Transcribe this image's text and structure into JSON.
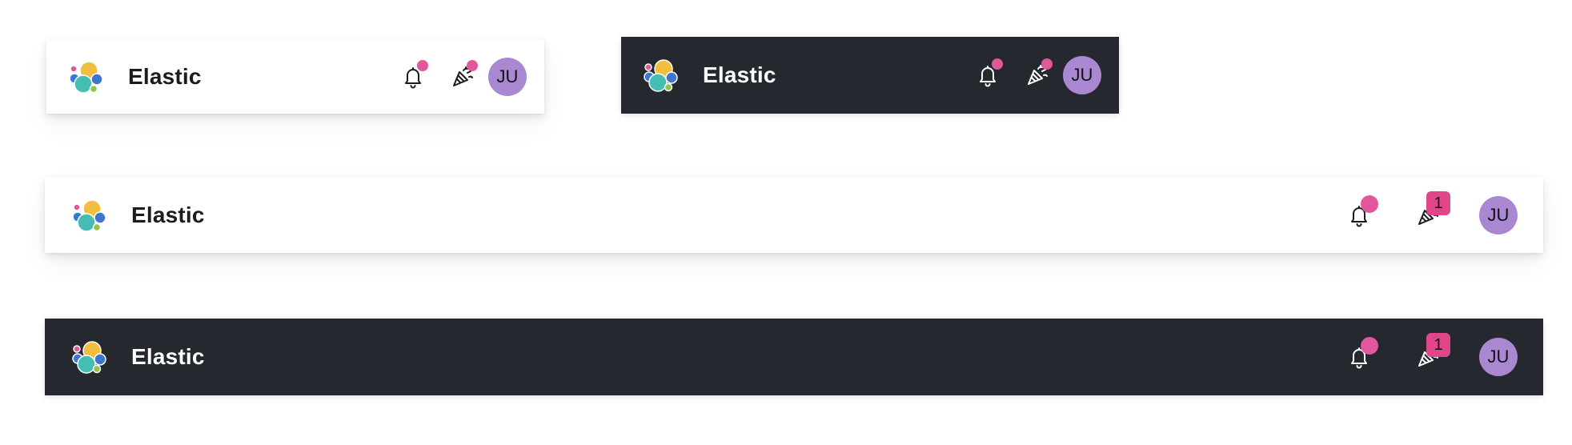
{
  "colors": {
    "light_background": "#ffffff",
    "dark_background": "#25282f",
    "notification_pink": "#e2569a",
    "avatar_purple": "#a987d1",
    "logo_yellow": "#f3bd3d",
    "logo_teal": "#46bdb3",
    "logo_blue": "#3c76cf",
    "logo_pink": "#e2569a",
    "logo_green": "#8ec64b"
  },
  "icons": {
    "logo": "elastic-logo-icon",
    "bell": "bell-icon",
    "party": "party-popper-icon"
  },
  "headers": [
    {
      "theme": "light",
      "brand": "Elastic",
      "bell_has_dot": true,
      "party_badge": "",
      "avatar_initials": "JU"
    },
    {
      "theme": "dark",
      "brand": "Elastic",
      "bell_has_dot": true,
      "party_badge": "",
      "avatar_initials": "JU"
    },
    {
      "theme": "light",
      "brand": "Elastic",
      "bell_has_dot": true,
      "party_badge": "1",
      "avatar_initials": "JU"
    },
    {
      "theme": "dark",
      "brand": "Elastic",
      "bell_has_dot": true,
      "party_badge": "1",
      "avatar_initials": "JU"
    }
  ]
}
